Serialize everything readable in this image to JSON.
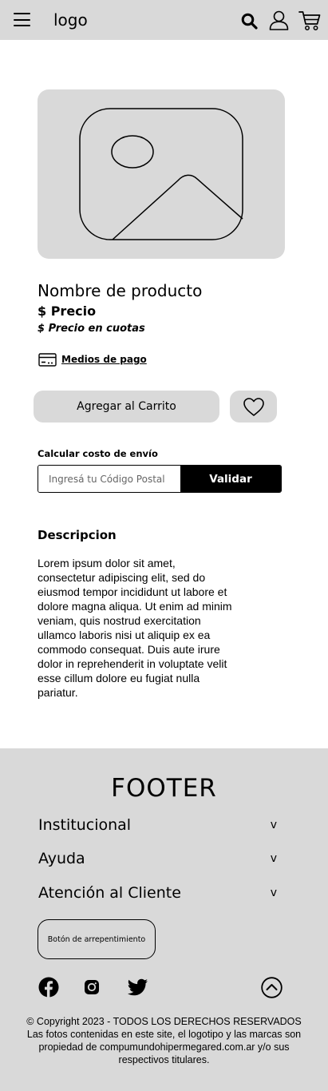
{
  "header": {
    "menu_icon": "hamburger-menu-icon",
    "logo": "logo",
    "search_icon": "search-icon",
    "user_icon": "user-icon",
    "cart_icon": "cart-icon"
  },
  "product": {
    "image_icon": "image-placeholder-icon",
    "name": "Nombre de producto",
    "price": "$ Precio",
    "installments": "$ Precio en cuotas",
    "payment_methods": "Medios de pago",
    "payment_icon": "credit-card-icon",
    "add_to_cart": "Agregar al Carrito",
    "favorite_icon": "heart-icon"
  },
  "shipping": {
    "title": "Calcular costo de envío",
    "placeholder": "Ingresá tu Código Postal",
    "button": "Validar"
  },
  "description": {
    "title": "Descripcion",
    "body": "Lorem ipsum dolor sit amet, consectetur adipiscing elit, sed do eiusmod tempor incididunt ut labore et dolore magna aliqua. Ut enim ad minim veniam, quis nostrud exercitation ullamco laboris nisi ut aliquip ex ea commodo consequat. Duis aute irure dolor in reprehenderit in voluptate velit esse cillum dolore eu fugiat nulla pariatur."
  },
  "footer": {
    "title": "FOOTER",
    "sections": [
      {
        "label": "Institucional",
        "chevron": "v"
      },
      {
        "label": "Ayuda",
        "chevron": "v"
      },
      {
        "label": "Atención al Cliente",
        "chevron": "v"
      }
    ],
    "regret_button": "Botón de arrepentimiento",
    "social_icons": [
      "facebook-icon",
      "instagram-icon",
      "twitter-icon"
    ],
    "back_to_top_icon": "chevron-up-circle-icon",
    "copyright": "© Copyright 2023 - TODOS LOS DERECHOS RESERVADOS",
    "legal": "Las fotos contenidas en este site, el logotipo y las marcas son propiedad de compumundohipermegared.com.ar y/o sus respectivos titulares."
  },
  "colors": {
    "gray": "#d9d9d9",
    "black": "#000000",
    "white": "#ffffff"
  }
}
